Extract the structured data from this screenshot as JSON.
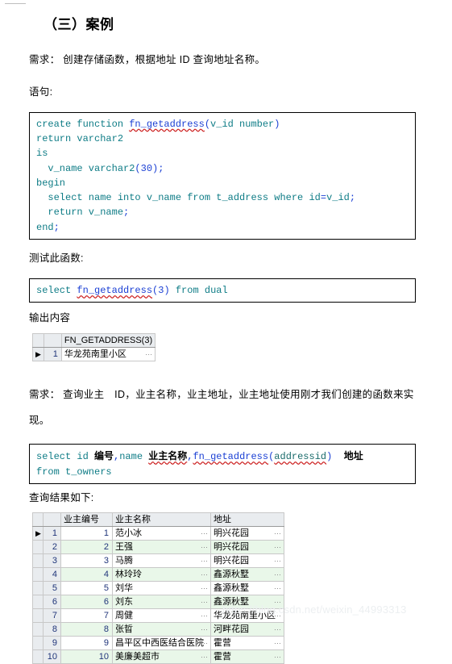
{
  "document": {
    "section_heading": "（三）案例",
    "requirement_1": "需求： 创建存储函数，根据地址 ID 查询地址名称。",
    "statement_label": "语句:",
    "test_label": "测试此函数:",
    "output_label": "输出内容",
    "requirement_2": "需求： 查询业主　ID，业主名称，业主地址，业主地址使用刚才我们创建的函数来实现。",
    "result_label": "查询结果如下:",
    "watermark": "https://blog.csdn.net/weixin_44993313"
  },
  "code_block_1": {
    "lines": [
      {
        "parts": [
          {
            "t": "create function ",
            "c": "kw"
          },
          {
            "t": "fn_getaddress",
            "c": "fnm"
          },
          {
            "t": "(",
            "c": "plain"
          },
          {
            "t": "v_id number",
            "c": "kw"
          },
          {
            "t": ")",
            "c": "plain"
          }
        ]
      },
      {
        "parts": [
          {
            "t": "return varchar2",
            "c": "kw"
          }
        ]
      },
      {
        "parts": [
          {
            "t": "is",
            "c": "kw"
          }
        ]
      },
      {
        "parts": [
          {
            "t": "  v_name varchar2",
            "c": "kw"
          },
          {
            "t": "(",
            "c": "plain"
          },
          {
            "t": "30",
            "c": "num"
          },
          {
            "t": ");",
            "c": "plain"
          }
        ]
      },
      {
        "parts": [
          {
            "t": "begin",
            "c": "kw"
          }
        ]
      },
      {
        "parts": [
          {
            "t": "  select name into v_name from t_address where id",
            "c": "kw"
          },
          {
            "t": "=",
            "c": "plain"
          },
          {
            "t": "v_id",
            "c": "kw"
          },
          {
            "t": ";",
            "c": "plain"
          }
        ]
      },
      {
        "parts": [
          {
            "t": "  return v_name",
            "c": "kw"
          },
          {
            "t": ";",
            "c": "plain"
          }
        ]
      },
      {
        "parts": [
          {
            "t": "end",
            "c": "kw"
          },
          {
            "t": ";",
            "c": "plain"
          }
        ]
      }
    ]
  },
  "code_block_2": {
    "lines": [
      {
        "parts": [
          {
            "t": "select ",
            "c": "kw"
          },
          {
            "t": "fn_getaddress",
            "c": "fnm"
          },
          {
            "t": "(",
            "c": "plain"
          },
          {
            "t": "3",
            "c": "num"
          },
          {
            "t": ") ",
            "c": "plain"
          },
          {
            "t": "from dual",
            "c": "kw"
          }
        ]
      }
    ]
  },
  "code_block_3": {
    "lines": [
      {
        "parts": [
          {
            "t": "select id ",
            "c": "kw"
          },
          {
            "t": "编号",
            "c": "cn"
          },
          {
            "t": ",",
            "c": "plain"
          },
          {
            "t": "name ",
            "c": "kw"
          },
          {
            "t": "业主名称",
            "c": "cn-u"
          },
          {
            "t": ",",
            "c": "plain"
          },
          {
            "t": "fn_getaddress",
            "c": "fnm"
          },
          {
            "t": "(",
            "c": "plain"
          },
          {
            "t": "addressid",
            "c": "sq"
          },
          {
            "t": ")  ",
            "c": "plain"
          },
          {
            "t": "地址",
            "c": "cn"
          }
        ]
      },
      {
        "parts": [
          {
            "t": "from t_owners",
            "c": "kw"
          }
        ]
      }
    ]
  },
  "output_grid": {
    "columns": [
      "",
      "",
      "FN_GETADDRESS(3)"
    ],
    "rows": [
      {
        "marker": "▶",
        "rownum": "1",
        "value": "华龙苑南里小区"
      }
    ]
  },
  "result_grid": {
    "columns": [
      "",
      "",
      "业主编号",
      "业主名称",
      "地址"
    ],
    "rows": [
      {
        "marker": "▶",
        "rownum": "1",
        "id": "1",
        "name": "范小冰",
        "address": "明兴花园"
      },
      {
        "marker": "",
        "rownum": "2",
        "id": "2",
        "name": "王强",
        "address": "明兴花园"
      },
      {
        "marker": "",
        "rownum": "3",
        "id": "3",
        "name": "马腾",
        "address": "明兴花园"
      },
      {
        "marker": "",
        "rownum": "4",
        "id": "4",
        "name": "林玲玲",
        "address": "鑫源秋墅"
      },
      {
        "marker": "",
        "rownum": "5",
        "id": "5",
        "name": "刘华",
        "address": "鑫源秋墅"
      },
      {
        "marker": "",
        "rownum": "6",
        "id": "6",
        "name": "刘东",
        "address": "鑫源秋墅"
      },
      {
        "marker": "",
        "rownum": "7",
        "id": "7",
        "name": "周健",
        "address": "华龙苑南里小区"
      },
      {
        "marker": "",
        "rownum": "8",
        "id": "8",
        "name": "张晢",
        "address": "河畔花园"
      },
      {
        "marker": "",
        "rownum": "9",
        "id": "9",
        "name": "昌平区中西医结合医院",
        "address": "霍营"
      },
      {
        "marker": "",
        "rownum": "10",
        "id": "10",
        "name": "美廉美超市",
        "address": "霍营"
      }
    ]
  },
  "colors": {
    "keyword": "#0e7c86",
    "identifier": "#1a3fd4",
    "spell_underline": "#cc1f1f",
    "grid_header_bg": "#e9ecef",
    "grid_alt_row_bg": "#e9f7e9",
    "watermark": "#eceff1"
  }
}
